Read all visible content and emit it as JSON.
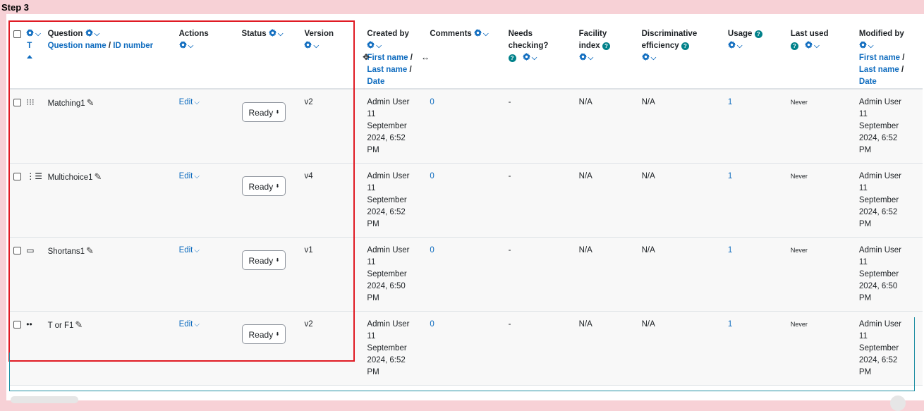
{
  "step_label": "Step 3",
  "header": {
    "type_label": "T",
    "question": "Question",
    "question_name": "Question name",
    "id_number": "ID number",
    "actions": "Actions",
    "status": "Status",
    "version": "Version",
    "created_by": "Created by",
    "first_name": "First name",
    "last_name": "Last name",
    "date": "Date",
    "comments": "Comments",
    "needs_checking_1": "Needs",
    "needs_checking_2": "checking?",
    "facility_1": "Facility",
    "facility_2": "index",
    "discrim_1": "Discriminative",
    "discrim_2": "efficiency",
    "usage": "Usage",
    "last_used": "Last used",
    "modified_by": "Modified by",
    "slash": "/",
    "help_glyph": "?"
  },
  "rows": [
    {
      "type_icon": "matching-icon",
      "name": "Matching1",
      "action": "Edit",
      "status": "Ready",
      "version": "v2",
      "created_name": "Admin User",
      "created_day": "11",
      "created_month": "September",
      "created_year": "2024, 6:52",
      "created_ampm": "PM",
      "comments": "0",
      "needs_checking": "-",
      "facility": "N/A",
      "discrim": "N/A",
      "usage": "1",
      "last_used": "Never",
      "modified_name": "Admin User",
      "modified_day": "11",
      "modified_month": "September",
      "modified_year": "2024, 6:52",
      "modified_ampm": "PM"
    },
    {
      "type_icon": "multichoice-icon",
      "name": "Multichoice1",
      "action": "Edit",
      "status": "Ready",
      "version": "v4",
      "created_name": "Admin User",
      "created_day": "11",
      "created_month": "September",
      "created_year": "2024, 6:52",
      "created_ampm": "PM",
      "comments": "0",
      "needs_checking": "-",
      "facility": "N/A",
      "discrim": "N/A",
      "usage": "1",
      "last_used": "Never",
      "modified_name": "Admin User",
      "modified_day": "11",
      "modified_month": "September",
      "modified_year": "2024, 6:52",
      "modified_ampm": "PM"
    },
    {
      "type_icon": "shortanswer-icon",
      "name": "Shortans1",
      "action": "Edit",
      "status": "Ready",
      "version": "v1",
      "created_name": "Admin User",
      "created_day": "11",
      "created_month": "September",
      "created_year": "2024, 6:50",
      "created_ampm": "PM",
      "comments": "0",
      "needs_checking": "-",
      "facility": "N/A",
      "discrim": "N/A",
      "usage": "1",
      "last_used": "Never",
      "modified_name": "Admin User",
      "modified_day": "11",
      "modified_month": "September",
      "modified_year": "2024, 6:50",
      "modified_ampm": "PM"
    },
    {
      "type_icon": "truefalse-icon",
      "name": "T or F1",
      "action": "Edit",
      "status": "Ready",
      "version": "v2",
      "created_name": "Admin User",
      "created_day": "11",
      "created_month": "September",
      "created_year": "2024, 6:52",
      "created_ampm": "PM",
      "comments": "0",
      "needs_checking": "-",
      "facility": "N/A",
      "discrim": "N/A",
      "usage": "1",
      "last_used": "Never",
      "modified_name": "Admin User",
      "modified_day": "11",
      "modified_month": "September",
      "modified_year": "2024, 6:52",
      "modified_ampm": "PM"
    }
  ],
  "colors": {
    "link": "#0f6cbf",
    "highlight": "#e01b24",
    "help": "#00818a",
    "background": "#f7d1d6"
  }
}
